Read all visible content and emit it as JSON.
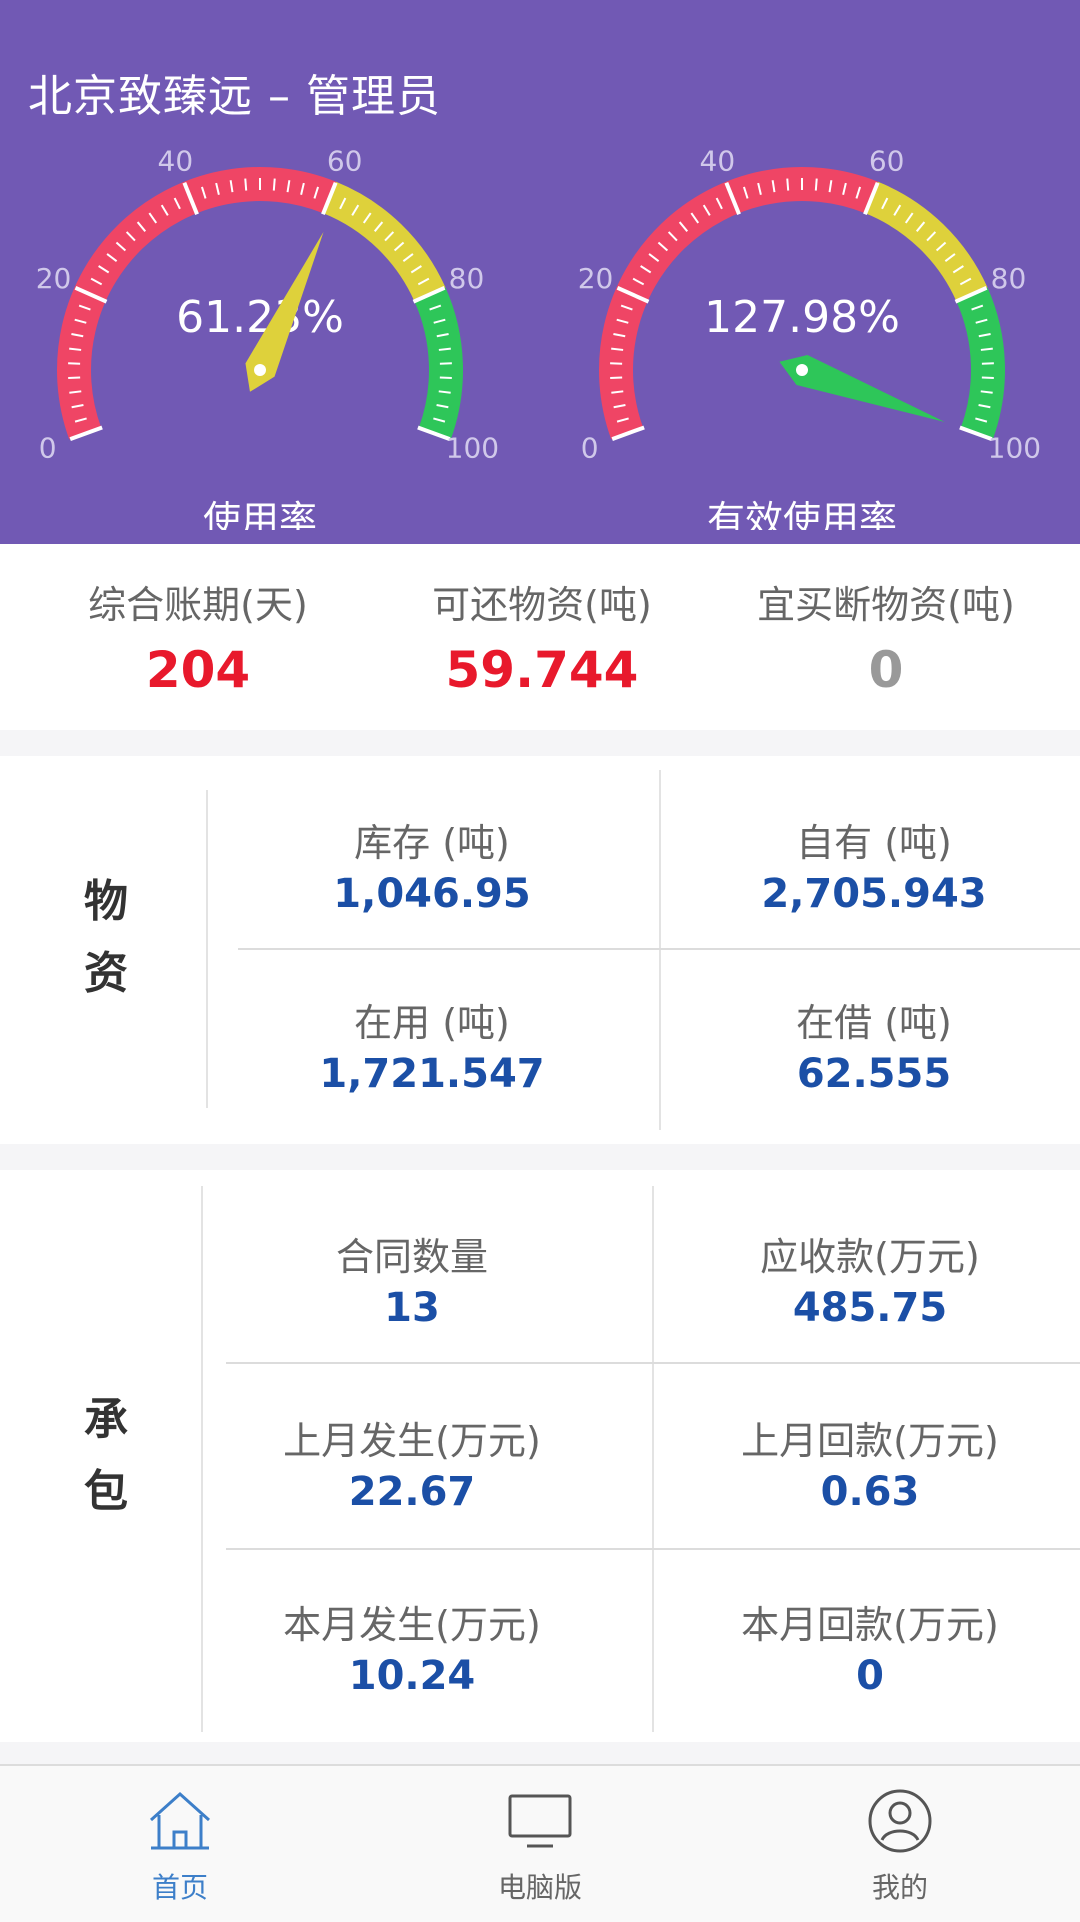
{
  "header": {
    "title": "北京致臻远 – 管理员"
  },
  "colors": {
    "header_bg": "#7159b4",
    "gauge_red": "#ef4565",
    "gauge_yellow": "#ded13b",
    "gauge_green": "#2ec659",
    "value_red": "#e8192c",
    "value_blue": "#1b4fa6",
    "value_gray": "#999999",
    "tab_active": "#3d7fc9",
    "tab_inactive": "#666666"
  },
  "gauges": [
    {
      "value_text": "61.23%",
      "label": "使用率",
      "value": 61.23,
      "needle_color": "#ded13b"
    },
    {
      "value_text": "127.98%",
      "label": "有效使用率",
      "value": 127.98,
      "needle_color": "#2ec659"
    }
  ],
  "gauge_scale": {
    "min": 0,
    "max": 100,
    "tick_labels": [
      "0",
      "20",
      "40",
      "60",
      "80",
      "100"
    ],
    "red_until": 60,
    "yellow_until": 80
  },
  "summary": [
    {
      "label": "综合账期(天)",
      "value": "204",
      "color": "#e8192c"
    },
    {
      "label": "可还物资(吨)",
      "value": "59.744",
      "color": "#e8192c"
    },
    {
      "label": "宜买断物资(吨)",
      "value": "0",
      "color": "#999999"
    }
  ],
  "materials": {
    "title": "物资",
    "cells": [
      {
        "label": "库存 (吨)",
        "value": "1,046.95"
      },
      {
        "label": "自有 (吨)",
        "value": "2,705.943"
      },
      {
        "label": "在用 (吨)",
        "value": "1,721.547"
      },
      {
        "label": "在借 (吨)",
        "value": "62.555"
      }
    ]
  },
  "contracts": {
    "title": "承包",
    "cells": [
      {
        "label": "合同数量",
        "value": "13"
      },
      {
        "label": "应收款(万元)",
        "value": "485.75"
      },
      {
        "label": "上月发生(万元)",
        "value": "22.67"
      },
      {
        "label": "上月回款(万元)",
        "value": "0.63"
      },
      {
        "label": "本月发生(万元)",
        "value": "10.24"
      },
      {
        "label": "本月回款(万元)",
        "value": "0"
      }
    ]
  },
  "tabbar": {
    "items": [
      {
        "label": "首页",
        "icon": "home-icon",
        "active": true
      },
      {
        "label": "电脑版",
        "icon": "monitor-icon",
        "active": false
      },
      {
        "label": "我的",
        "icon": "user-icon",
        "active": false
      }
    ]
  }
}
